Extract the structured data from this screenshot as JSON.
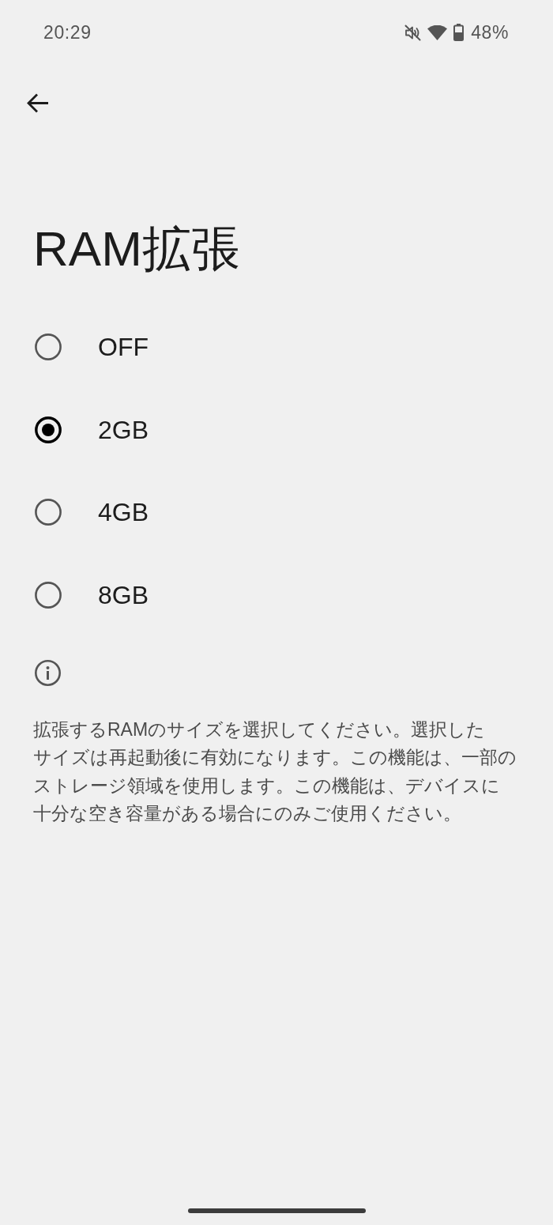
{
  "status_bar": {
    "time": "20:29",
    "battery": "48%"
  },
  "title": "RAM拡張",
  "options": [
    {
      "label": "OFF",
      "selected": false
    },
    {
      "label": "2GB",
      "selected": true
    },
    {
      "label": "4GB",
      "selected": false
    },
    {
      "label": "8GB",
      "selected": false
    }
  ],
  "info": {
    "text": "拡張するRAMのサイズを選択してください。選択したサイズは再起動後に有効になります。この機能は、一部のストレージ領域を使用します。この機能は、デバイスに十分な空き容量がある場合にのみご使用ください。"
  }
}
